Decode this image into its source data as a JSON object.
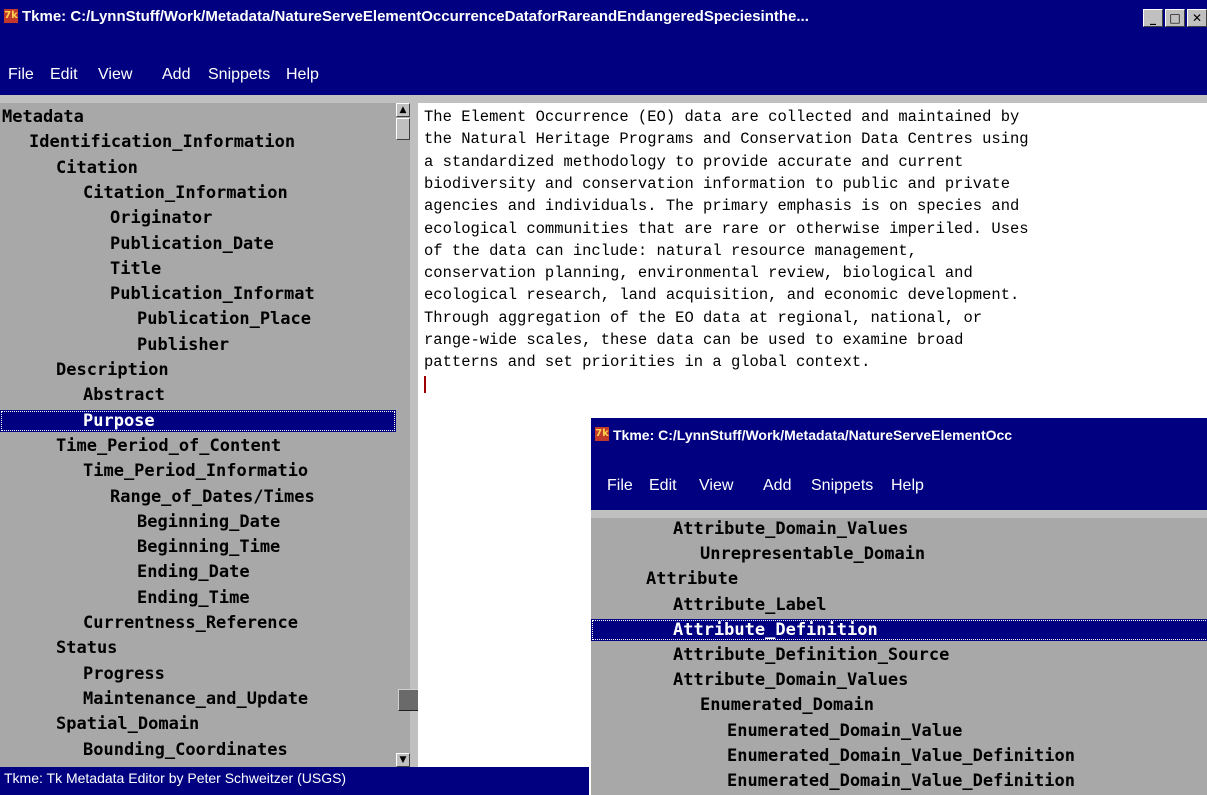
{
  "main_window": {
    "title": "Tkme: C:/LynnStuff/Work/Metadata/NatureServeElementOccurrenceDataforRareandEndangeredSpeciesinthe...",
    "icon": "tk-feather-icon",
    "buttons": {
      "minimize": "_",
      "maximize": "□",
      "close": "✕"
    },
    "menu": [
      "File",
      "Edit",
      "View",
      "Add",
      "Snippets",
      "Help"
    ],
    "tree": [
      "Metadata",
      "  Identification_Information",
      "    Citation",
      "      Citation_Information",
      "        Originator",
      "        Publication_Date",
      "        Title",
      "        Publication_Informat",
      "          Publication_Place",
      "          Publisher",
      "    Description",
      "      Abstract",
      "      Purpose",
      "    Time_Period_of_Content",
      "      Time_Period_Informatio",
      "        Range_of_Dates/Times",
      "          Beginning_Date",
      "          Beginning_Time",
      "          Ending_Date",
      "          Ending_Time",
      "      Currentness_Reference",
      "    Status",
      "      Progress",
      "      Maintenance_and_Update",
      "    Spatial_Domain",
      "      Bounding_Coordinates"
    ],
    "selected_tree_item": "Purpose",
    "editor_text": [
      "The Element Occurrence (EO) data are collected and maintained by",
      "the Natural Heritage Programs and Conservation Data Centres using",
      "a standardized methodology to provide accurate and current",
      "biodiversity and conservation information to public and private",
      "agencies and individuals. The primary emphasis is on species and",
      "ecological communities that are rare or otherwise imperiled. Uses",
      "of the data can include: natural resource management,",
      "conservation planning, environmental review, biological and",
      "ecological research, land acquisition, and economic development.",
      "Through aggregation of the EO data at regional, national, or",
      "range-wide scales, these data can be used to examine broad",
      "patterns and set priorities in a global context."
    ],
    "status": "Tkme: Tk Metadata Editor by Peter Schweitzer (USGS)"
  },
  "second_window": {
    "title": "Tkme: C:/LynnStuff/Work/Metadata/NatureServeElementOcc",
    "icon": "tk-feather-icon",
    "menu": [
      "File",
      "Edit",
      "View",
      "Add",
      "Snippets",
      "Help"
    ],
    "tree": [
      "    Attribute_Domain_Values",
      "      Unrepresentable_Domain",
      "  Attribute",
      "    Attribute_Label",
      "    Attribute_Definition",
      "    Attribute_Definition_Source",
      "    Attribute_Domain_Values",
      "      Enumerated_Domain",
      "        Enumerated_Domain_Value",
      "        Enumerated_Domain_Value_Definition",
      "        Enumerated_Domain_Value_Definition"
    ],
    "selected_tree_item": "Attribute_Definition"
  },
  "colors": {
    "title_bg": "#000080",
    "tree_bg": "#a8a8a8",
    "selection_bg": "#000080",
    "caret": "#a00000"
  }
}
